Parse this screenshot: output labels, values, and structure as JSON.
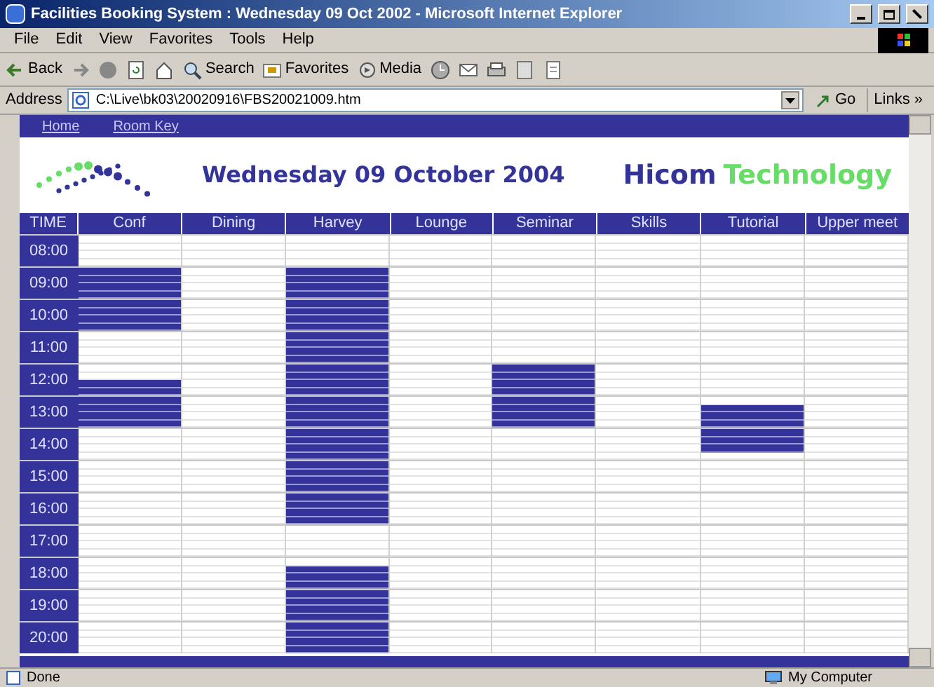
{
  "window": {
    "title": "Facilities Booking System : Wednesday 09 Oct 2002 - Microsoft Internet Explorer"
  },
  "menu": [
    "File",
    "Edit",
    "View",
    "Favorites",
    "Tools",
    "Help"
  ],
  "toolbar": [
    {
      "kind": "back",
      "label": "Back"
    },
    {
      "kind": "forward"
    },
    {
      "kind": "stop"
    },
    {
      "kind": "refresh"
    },
    {
      "kind": "home"
    },
    {
      "kind": "search",
      "label": "Search"
    },
    {
      "kind": "favorites",
      "label": "Favorites"
    },
    {
      "kind": "media",
      "label": "Media"
    },
    {
      "kind": "history"
    },
    {
      "kind": "mail"
    },
    {
      "kind": "print"
    },
    {
      "kind": "edit"
    },
    {
      "kind": "discuss"
    }
  ],
  "address": {
    "label": "Address",
    "value": "C:\\Live\\bk03\\20020916\\FBS20021009.htm",
    "go": "Go",
    "links": "Links »"
  },
  "nav": [
    "Home",
    "Room Key"
  ],
  "header": {
    "date": "Wednesday 09 October 2004",
    "brand_1": "Hicom",
    "brand_2": "Technology"
  },
  "columns": [
    "TIME",
    "Conf",
    "Dining",
    "Harvey",
    "Lounge",
    "Seminar",
    "Skills",
    "Tutorial",
    "Upper meet"
  ],
  "rows": [
    {
      "time": "08:00",
      "booked": [
        [
          false,
          false,
          false,
          false
        ],
        [
          false,
          false,
          false,
          false
        ],
        [
          false,
          false,
          false,
          false
        ],
        [
          false,
          false,
          false,
          false
        ],
        [
          false,
          false,
          false,
          false
        ],
        [
          false,
          false,
          false,
          false
        ],
        [
          false,
          false,
          false,
          false
        ],
        [
          false,
          false,
          false,
          false
        ]
      ]
    },
    {
      "time": "09:00",
      "booked": [
        [
          true,
          true,
          true,
          true
        ],
        [
          false,
          false,
          false,
          false
        ],
        [
          true,
          true,
          true,
          true
        ],
        [
          false,
          false,
          false,
          false
        ],
        [
          false,
          false,
          false,
          false
        ],
        [
          false,
          false,
          false,
          false
        ],
        [
          false,
          false,
          false,
          false
        ],
        [
          false,
          false,
          false,
          false
        ]
      ]
    },
    {
      "time": "10:00",
      "booked": [
        [
          true,
          true,
          true,
          true
        ],
        [
          false,
          false,
          false,
          false
        ],
        [
          true,
          true,
          true,
          true
        ],
        [
          false,
          false,
          false,
          false
        ],
        [
          false,
          false,
          false,
          false
        ],
        [
          false,
          false,
          false,
          false
        ],
        [
          false,
          false,
          false,
          false
        ],
        [
          false,
          false,
          false,
          false
        ]
      ]
    },
    {
      "time": "11:00",
      "booked": [
        [
          false,
          false,
          false,
          false
        ],
        [
          false,
          false,
          false,
          false
        ],
        [
          true,
          true,
          true,
          true
        ],
        [
          false,
          false,
          false,
          false
        ],
        [
          false,
          false,
          false,
          false
        ],
        [
          false,
          false,
          false,
          false
        ],
        [
          false,
          false,
          false,
          false
        ],
        [
          false,
          false,
          false,
          false
        ]
      ]
    },
    {
      "time": "12:00",
      "booked": [
        [
          false,
          false,
          true,
          true
        ],
        [
          false,
          false,
          false,
          false
        ],
        [
          true,
          true,
          true,
          true
        ],
        [
          false,
          false,
          false,
          false
        ],
        [
          true,
          true,
          true,
          true
        ],
        [
          false,
          false,
          false,
          false
        ],
        [
          false,
          false,
          false,
          false
        ],
        [
          false,
          false,
          false,
          false
        ]
      ]
    },
    {
      "time": "13:00",
      "booked": [
        [
          true,
          true,
          true,
          true
        ],
        [
          false,
          false,
          false,
          false
        ],
        [
          true,
          true,
          true,
          true
        ],
        [
          false,
          false,
          false,
          false
        ],
        [
          true,
          true,
          true,
          true
        ],
        [
          false,
          false,
          false,
          false
        ],
        [
          false,
          true,
          true,
          true
        ],
        [
          false,
          false,
          false,
          false
        ]
      ]
    },
    {
      "time": "14:00",
      "booked": [
        [
          false,
          false,
          false,
          false
        ],
        [
          false,
          false,
          false,
          false
        ],
        [
          true,
          true,
          true,
          true
        ],
        [
          false,
          false,
          false,
          false
        ],
        [
          false,
          false,
          false,
          false
        ],
        [
          false,
          false,
          false,
          false
        ],
        [
          true,
          true,
          true,
          false
        ],
        [
          false,
          false,
          false,
          false
        ]
      ]
    },
    {
      "time": "15:00",
      "booked": [
        [
          false,
          false,
          false,
          false
        ],
        [
          false,
          false,
          false,
          false
        ],
        [
          true,
          true,
          true,
          true
        ],
        [
          false,
          false,
          false,
          false
        ],
        [
          false,
          false,
          false,
          false
        ],
        [
          false,
          false,
          false,
          false
        ],
        [
          false,
          false,
          false,
          false
        ],
        [
          false,
          false,
          false,
          false
        ]
      ]
    },
    {
      "time": "16:00",
      "booked": [
        [
          false,
          false,
          false,
          false
        ],
        [
          false,
          false,
          false,
          false
        ],
        [
          true,
          true,
          true,
          true
        ],
        [
          false,
          false,
          false,
          false
        ],
        [
          false,
          false,
          false,
          false
        ],
        [
          false,
          false,
          false,
          false
        ],
        [
          false,
          false,
          false,
          false
        ],
        [
          false,
          false,
          false,
          false
        ]
      ]
    },
    {
      "time": "17:00",
      "booked": [
        [
          false,
          false,
          false,
          false
        ],
        [
          false,
          false,
          false,
          false
        ],
        [
          false,
          false,
          false,
          false
        ],
        [
          false,
          false,
          false,
          false
        ],
        [
          false,
          false,
          false,
          false
        ],
        [
          false,
          false,
          false,
          false
        ],
        [
          false,
          false,
          false,
          false
        ],
        [
          false,
          false,
          false,
          false
        ]
      ]
    },
    {
      "time": "18:00",
      "booked": [
        [
          false,
          false,
          false,
          false
        ],
        [
          false,
          false,
          false,
          false
        ],
        [
          false,
          true,
          true,
          true
        ],
        [
          false,
          false,
          false,
          false
        ],
        [
          false,
          false,
          false,
          false
        ],
        [
          false,
          false,
          false,
          false
        ],
        [
          false,
          false,
          false,
          false
        ],
        [
          false,
          false,
          false,
          false
        ]
      ]
    },
    {
      "time": "19:00",
      "booked": [
        [
          false,
          false,
          false,
          false
        ],
        [
          false,
          false,
          false,
          false
        ],
        [
          true,
          true,
          true,
          true
        ],
        [
          false,
          false,
          false,
          false
        ],
        [
          false,
          false,
          false,
          false
        ],
        [
          false,
          false,
          false,
          false
        ],
        [
          false,
          false,
          false,
          false
        ],
        [
          false,
          false,
          false,
          false
        ]
      ]
    },
    {
      "time": "20:00",
      "booked": [
        [
          false,
          false,
          false,
          false
        ],
        [
          false,
          false,
          false,
          false
        ],
        [
          true,
          true,
          true,
          true
        ],
        [
          false,
          false,
          false,
          false
        ],
        [
          false,
          false,
          false,
          false
        ],
        [
          false,
          false,
          false,
          false
        ],
        [
          false,
          false,
          false,
          false
        ],
        [
          false,
          false,
          false,
          false
        ]
      ]
    }
  ],
  "status_bar": {
    "text": "Done",
    "zone": "My Computer"
  }
}
